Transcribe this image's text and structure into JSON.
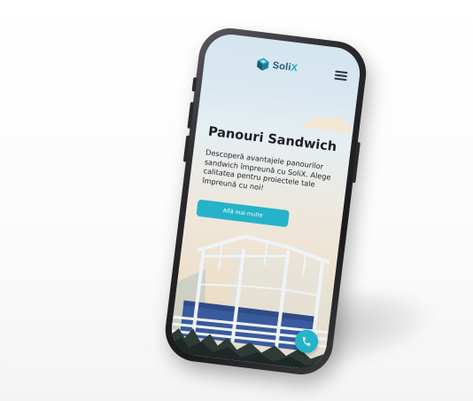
{
  "header": {
    "logo_text_main": "Soli",
    "logo_text_accent": "X",
    "logo_icon": "cube-icon",
    "menu_icon": "hamburger-menu-icon"
  },
  "hero": {
    "title": "Panouri Sandwich",
    "description": "Descoperă avantajele panourilor sandwich împreună cu SoliX. Alege calitatea pentru proiectele tale împreună cu noi!",
    "cta_label": "Află mai multe"
  },
  "floating": {
    "call_icon": "phone-icon"
  },
  "colors": {
    "accent": "#24b3c8",
    "brand_dark": "#1d5a78",
    "title": "#1e1f24",
    "structure_blue": "#3a5a9e"
  }
}
